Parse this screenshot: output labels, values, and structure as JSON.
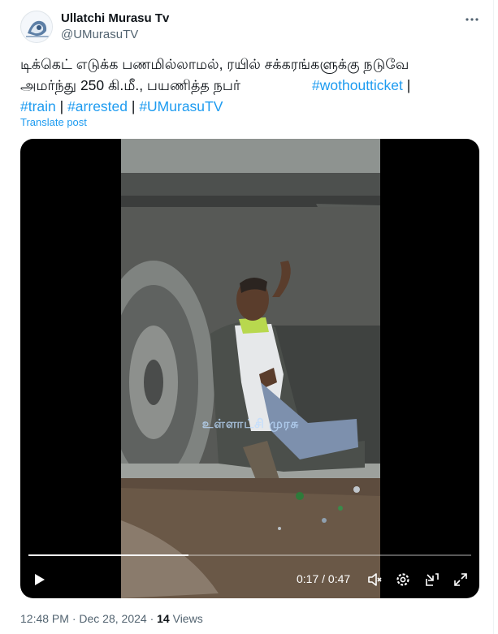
{
  "author": {
    "name": "Ullatchi Murasu Tv",
    "handle": "@UMurasuTV"
  },
  "tweet": {
    "line1": "டிக்கெட் எடுக்க பணமில்லாமல், ரயில் சக்கரங்களுக்கு நடுவே",
    "line2_text": "அமர்ந்து 250 கி.மீ., பயணித்த நபர்",
    "hashtags": [
      "#wothoutticket",
      "#train",
      "#arrested",
      "#UMurasuTV"
    ],
    "separator": "|",
    "translate_label": "Translate post"
  },
  "video": {
    "watermark": "உள்ளாட்சி முரசு",
    "current_time": "0:17",
    "duration": "0:47",
    "time_separator": "/",
    "progress": 0.3617
  },
  "icons": {
    "more": "more-dots-icon",
    "play": "play-icon",
    "volume": "volume-icon",
    "settings": "settings-gear-icon",
    "pip": "picture-in-picture-icon",
    "fullscreen": "fullscreen-icon"
  },
  "meta": {
    "time": "12:48 PM",
    "dot": "·",
    "date": "Dec 28, 2024",
    "views_count": "14",
    "views_label": "Views"
  },
  "colors": {
    "accent": "#1d9bf0",
    "text": "#0f1419",
    "secondary": "#536471"
  }
}
